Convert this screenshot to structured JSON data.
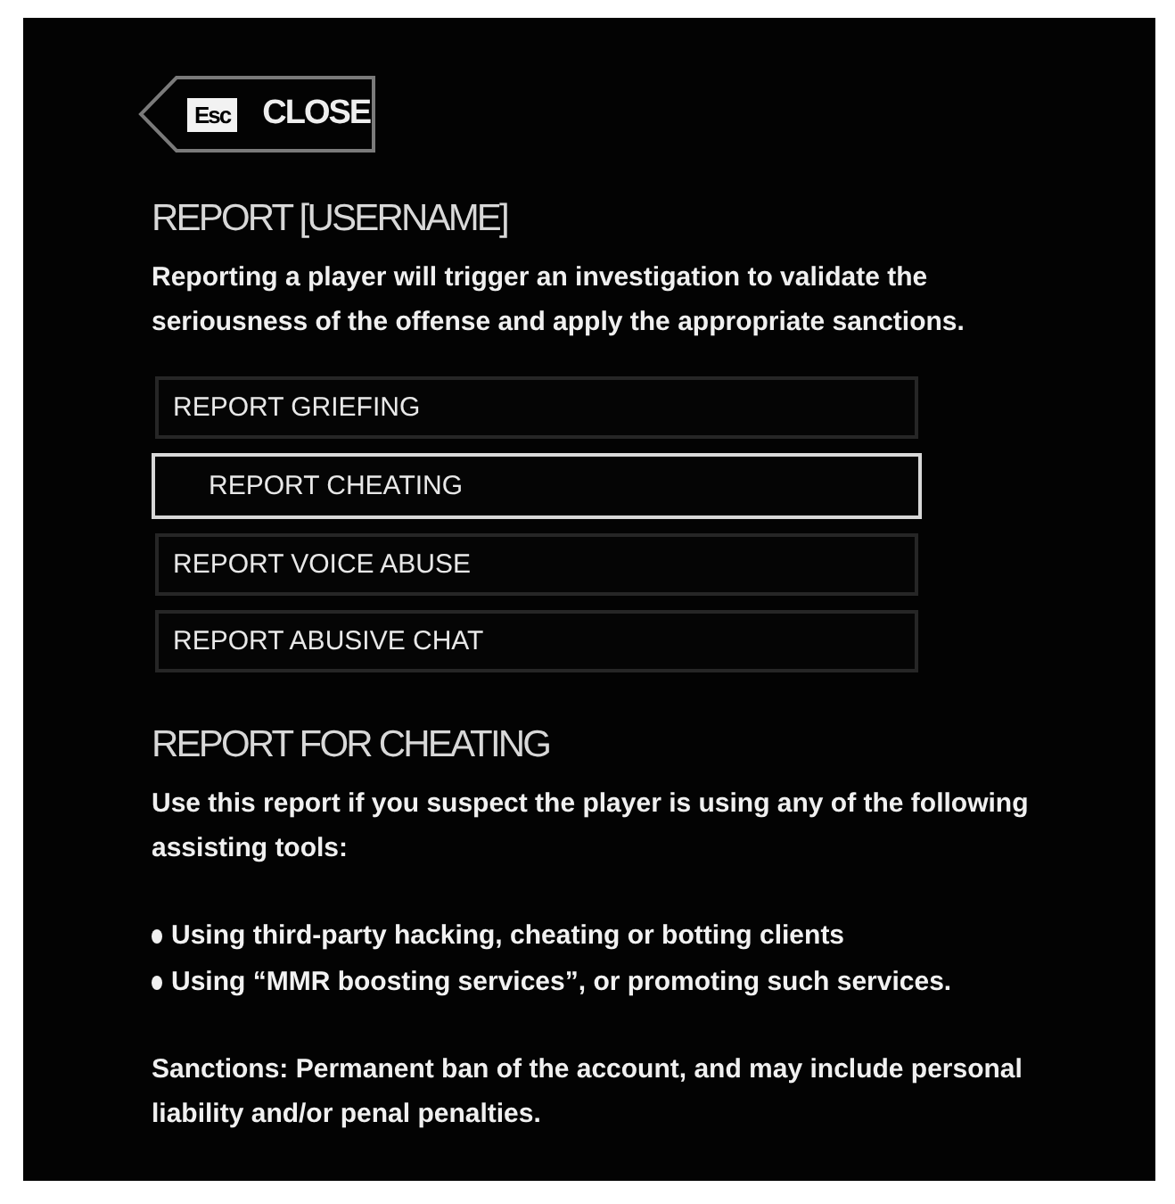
{
  "close_button": {
    "key": "Esc",
    "label": "CLOSE"
  },
  "title": "REPORT [USERNAME]",
  "intro": "Reporting a player will trigger an investigation to validate the seriousness of the offense and apply the appropriate sanctions.",
  "options": [
    {
      "label": "REPORT GRIEFING",
      "selected": false
    },
    {
      "label": "REPORT CHEATING",
      "selected": true
    },
    {
      "label": "REPORT VOICE ABUSE",
      "selected": false
    },
    {
      "label": "REPORT ABUSIVE CHAT",
      "selected": false
    }
  ],
  "detail": {
    "heading": "REPORT FOR CHEATING",
    "description": "Use this report if you suspect the player is using any of the following assisting tools:",
    "bullets": [
      "Using third-party hacking, cheating or botting clients",
      "Using “MMR boosting services”, or promoting such services."
    ],
    "sanctions": "Sanctions: Permanent ban of the account, and may include personal liability and/or penal penalties."
  }
}
